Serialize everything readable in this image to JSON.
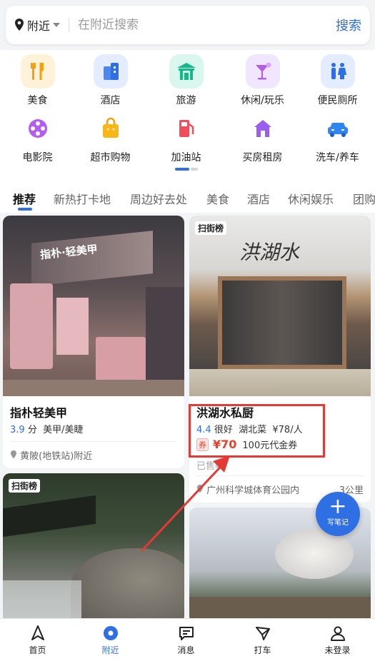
{
  "search": {
    "location": "附近",
    "placeholder": "在附近搜索",
    "button": "搜索"
  },
  "categories": [
    {
      "label": "美食",
      "icon": "food-icon"
    },
    {
      "label": "酒店",
      "icon": "hotel-icon"
    },
    {
      "label": "旅游",
      "icon": "travel-icon"
    },
    {
      "label": "休闲/玩乐",
      "icon": "cocktail-icon"
    },
    {
      "label": "便民厕所",
      "icon": "restroom-icon"
    },
    {
      "label": "电影院",
      "icon": "film-reel-icon"
    },
    {
      "label": "超市购物",
      "icon": "shopping-bag-icon"
    },
    {
      "label": "加油站",
      "icon": "fuel-pump-icon"
    },
    {
      "label": "买房租房",
      "icon": "house-icon"
    },
    {
      "label": "洗车/养车",
      "icon": "car-icon"
    }
  ],
  "tabs": [
    "推荐",
    "新热打卡地",
    "周边好去处",
    "美食",
    "酒店",
    "休闲娱乐",
    "团购"
  ],
  "cards": {
    "left1": {
      "title": "指朴轻美甲",
      "score": "3.9",
      "score_unit": "分",
      "category": "美甲/美睫",
      "location": "黄陂(地铁站)附近",
      "sign": "指朴·轻美甲"
    },
    "right1": {
      "badge": "扫街榜",
      "title": "洪湖水私厨",
      "score": "4.4",
      "rating_text": "很好",
      "category": "湖北菜",
      "price": "¥78/人",
      "coupon_tag": "券",
      "coupon_price": "¥70",
      "coupon_desc": "100元代金券",
      "sold": "已售42",
      "location": "广州科学城体育公园内",
      "distance": "3公里",
      "sign": "洪湖水"
    },
    "left2": {
      "badge": "扫街榜"
    }
  },
  "fab": {
    "label": "写笔记"
  },
  "bottom_nav": [
    {
      "label": "首页",
      "icon": "navigation-arrow-icon"
    },
    {
      "label": "附近",
      "icon": "location-pin-icon"
    },
    {
      "label": "消息",
      "icon": "message-icon"
    },
    {
      "label": "打车",
      "icon": "taxi-icon"
    },
    {
      "label": "未登录",
      "icon": "user-icon"
    }
  ],
  "colors": {
    "accent": "#2f6fe4",
    "price_red": "#e8412c",
    "annotation_red": "#e53935"
  }
}
